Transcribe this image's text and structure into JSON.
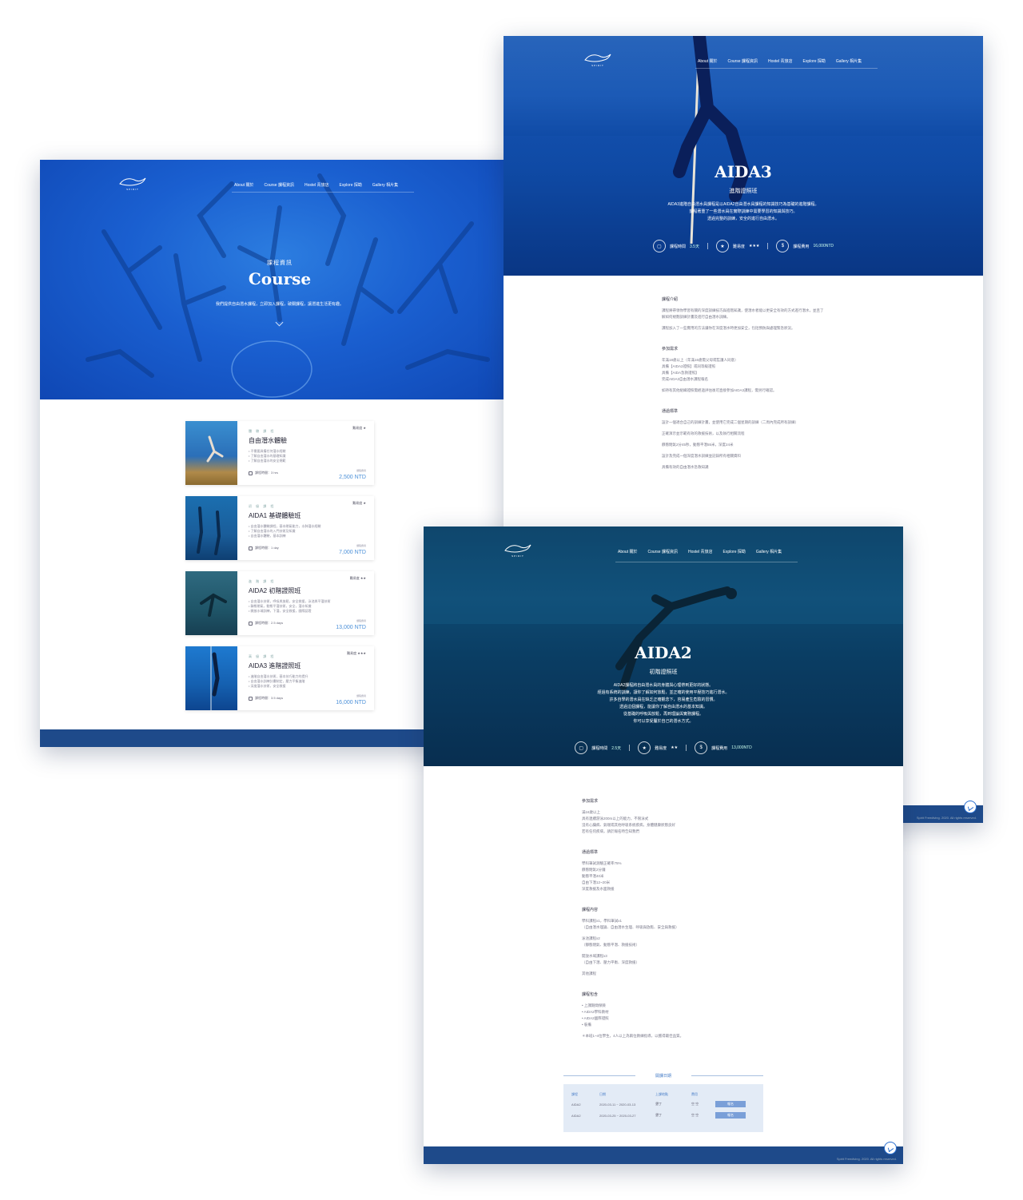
{
  "nav": [
    "About 關於",
    "Course 課程資訊",
    "Hostel 青旅店",
    "Explore 探勘",
    "Gallery 相片集"
  ],
  "logo_sub": "SPIRIT",
  "course_page": {
    "kicker": "課程資訊",
    "title": "Course",
    "description": "我們提供自由潛水課程，立即加入課程，破關課程，讓潛進生活更有趣。",
    "cards": [
      {
        "kicker": "體 驗 課 程",
        "title": "自由潛水體驗",
        "level": "難易度 ★",
        "bullets": [
          "不需要具備任何潛水經驗",
          "了解自由潛水的基礎知識",
          "了解自由潛水的安全規範"
        ],
        "duration": "課程時間：3 hrs",
        "price_label": "課程費用",
        "price": "2,500 NTD"
      },
      {
        "kicker": "初 級 課 程",
        "title": "AIDA1 基礎體驗班",
        "level": "難易度 ★",
        "bullets": [
          "自由潛水體驗課程，基本閉氣能力，水肺潛水經驗",
          "了解自由潛水的入門技術及知識",
          "自由潛水體驗，基本訓練"
        ],
        "duration": "課程時間：1 day",
        "price_label": "課程費用",
        "price": "7,000 NTD"
      },
      {
        "kicker": "進 階 課 程",
        "title": "AIDA2 初階證照班",
        "level": "難易度 ★★",
        "bullets": [
          "自由潛水技術，呼吸與放鬆，安全救援，泳池與平潛技術",
          "靜態閉氣，動態平潛技術，安全，潛水知識",
          "開放水域訓練，下潛，安全救援，國際認證"
        ],
        "duration": "課程時間：2.5 days",
        "price_label": "課程費用",
        "price": "13,000 NTD"
      },
      {
        "kicker": "高 級 課 程",
        "title": "AIDA3 進階證照班",
        "level": "難易度 ★★★",
        "bullets": [
          "進階自由潛水技術，基本技巧能力的提升",
          "自由潛水訓練計畫制定，壓力平衡進階",
          "深度潛水技術，安全救援"
        ],
        "duration": "課程時間：3.5 days",
        "price_label": "課程費用",
        "price": "16,000 NTD"
      }
    ]
  },
  "aida3_page": {
    "title": "AIDA3",
    "subtitle": "進階證照班",
    "description": [
      "AIDA3進階自由潛水員課程是以AIDA2自由潛水員課程的知識技巧為基礎的進階課程。",
      "課程著重了一些潛水員在實際訓練中需要學習的知識與技巧。",
      "透過完整的訓練，安全的進行自由潛水。"
    ],
    "stats": {
      "duration_label": "課程時間",
      "duration": "3.5天",
      "level_label": "難易度",
      "level": "★★★",
      "price_label": "課程費用",
      "price": "16,000NTD"
    },
    "sections": [
      {
        "heading": "課程介紹",
        "paras": [
          "課程將帶領你學習有關的深度訓練技巧與進階知識，使潛水者能以更安全有效的方式進行潛水，並且了解如何規劃訓練計畫及進行自由潛水訓練。",
          "課程加入了一些實用的方法讓你在深度潛水時更加安全，包括預防與處理緊急狀況。"
        ]
      },
      {
        "heading": "參加需求",
        "paras": [
          "年滿18歲以上（年滿16歲需父母或監護人同意）",
          "具備【AIDA2證照】或同等級證照",
          "具備【AIDA急救證照】",
          "完成AIDA3自由潛水課程報名",
          "如持有其他組織證照需經過評估後可直接參加AIDA3課程，需另行確認。"
        ]
      },
      {
        "heading": "通過標準",
        "paras": [
          "設計一個適合自己的訓練計畫，並使用它完成二個星期的訓練（二周內完成所有訓練）",
          "正確演示並示範有效的救援技術，以及執行相關流程",
          "靜態閉氣2分45秒，動態平潛55米，深度24米",
          "設計及完成一個深度潛水訓練並記錄所有相關資料",
          "具備有效的自由潛水急救知識"
        ]
      }
    ],
    "copyright": "Spirit Freediving. 2020. All rights reserved."
  },
  "aida2_page": {
    "title": "AIDA2",
    "subtitle": "初階證照班",
    "description": [
      "AIDA2課程將自由潛水員的身體與心理帶到更好的狀態。",
      "經過有系統的訓練，讓你了解如何放鬆，並正確的使用平壓技巧進行潛水。",
      "許多自學的潛水員在缺乏正確觀念下，容易產生危險的習慣。",
      "透過這個課程，能讓你了解自由潛水的基本知識。",
      "從基礎的呼吸與放鬆，再到理論與實務課程。",
      "你可以享受屬於自己的潛水方式。"
    ],
    "stats": {
      "duration_label": "課程時間",
      "duration": "2.5天",
      "level_label": "難易度",
      "level": "★★",
      "price_label": "課程費用",
      "price": "13,000NTD"
    },
    "sections": [
      {
        "heading": "參加需求",
        "paras": [
          "滿16歲以上",
          "具有連續游泳200m以上的能力，不限泳式",
          "沒有心臟病、氣喘或其他呼吸系統疾病，身體健康狀態良好",
          "若有任何疾病，請於報名時告知我們"
        ]
      },
      {
        "heading": "通過標準",
        "paras": [
          "學科筆試測驗正確率75%",
          "靜態閉氣2分鐘",
          "動態平潛40米",
          "自由下潛12~20米",
          "深度救援及水面救援"
        ]
      },
      {
        "heading": "課程內容",
        "paras": [
          "學科課程x1，學科筆試x1",
          "（自由潛水理論、自由潛水生理、呼吸與放鬆、安全與救援）",
          "泳池課程x2",
          "（靜態閉氣、動態平潛、救援技術）",
          "開放水域課程x3",
          "（自由下潛、壓力平衡、深度救援）",
          "其他課程"
        ]
      },
      {
        "heading": "課程包含",
        "paras": [
          "• 上課期間保險",
          "• AIDA2學科教材",
          "• AIDA2國際證照",
          "• 裝備"
        ]
      }
    ],
    "note": "＊本班1~4位學生，4人以上為兩位教練指導，以獲得最佳品質。",
    "schedule_title": "開課日期",
    "schedule_headers": [
      "課程",
      "日期",
      "上課地點",
      "費用",
      ""
    ],
    "schedule_rows": [
      {
        "course": "AIDA2",
        "date": "2020-03-11 ~ 2020-03-13",
        "place": "墾丁",
        "fee": "空 空",
        "action": "報名"
      },
      {
        "course": "AIDA2",
        "date": "2020-03-25 ~ 2020-03-27",
        "place": "墾丁",
        "fee": "空 空",
        "action": "報名"
      }
    ],
    "copyright": "Spirit Freediving. 2020. All rights reserved."
  }
}
